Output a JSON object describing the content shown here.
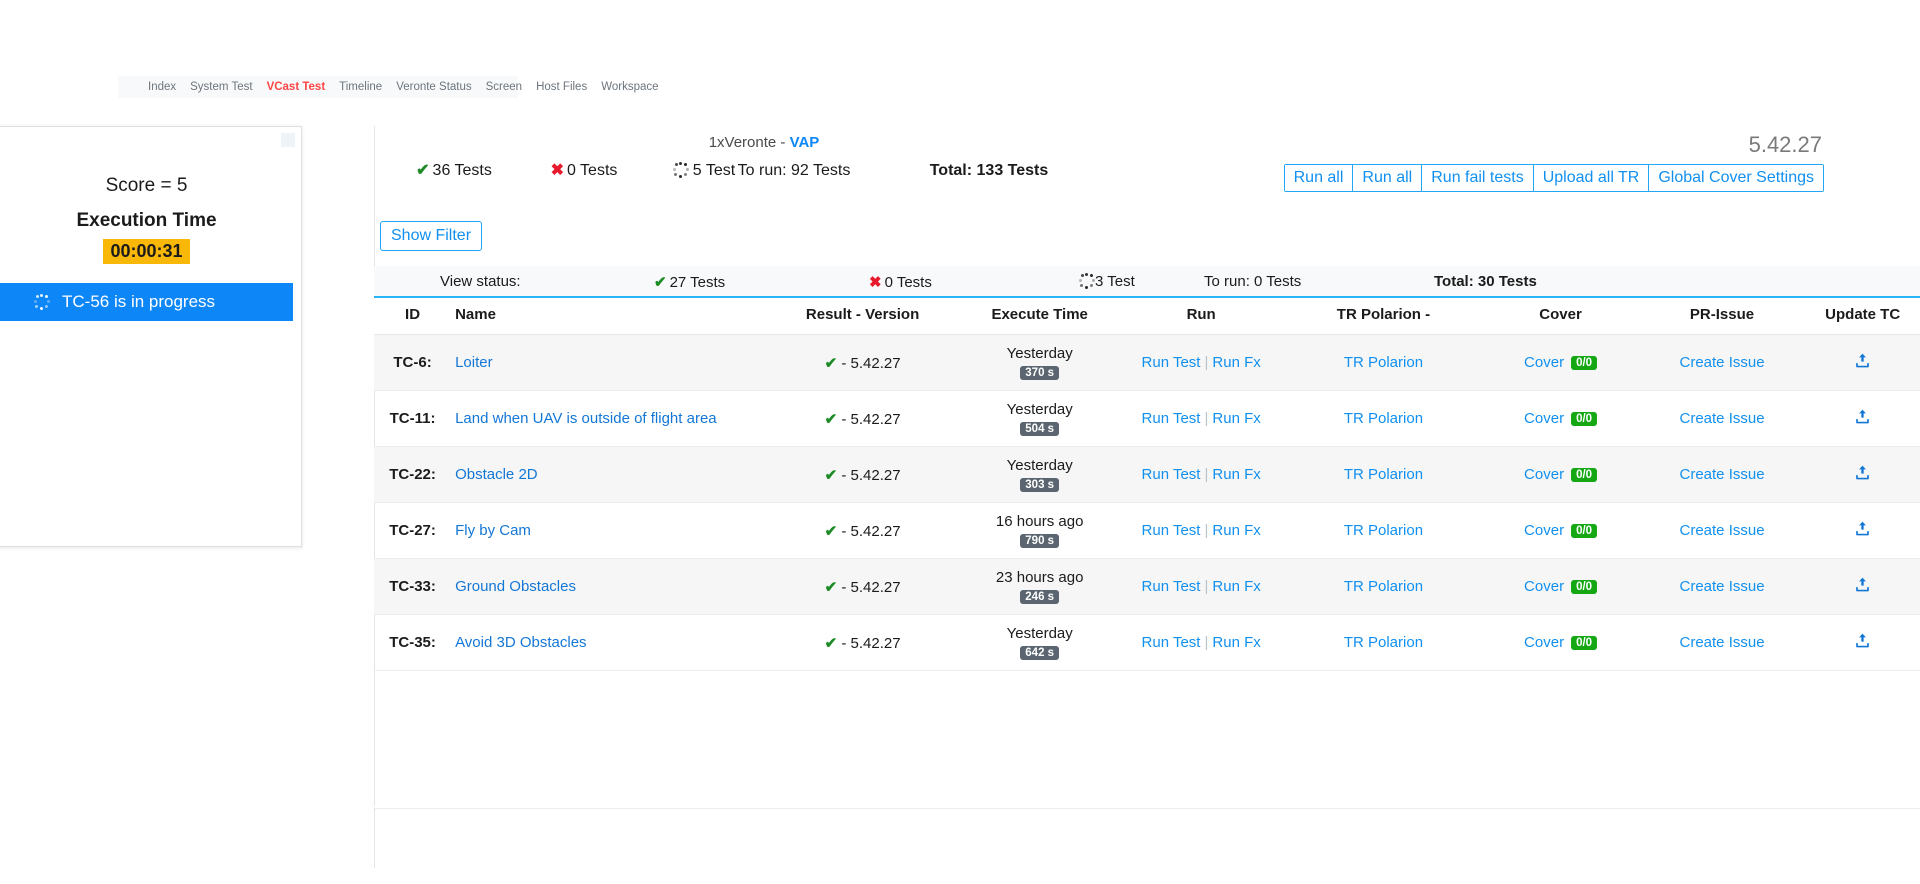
{
  "nav": {
    "items": [
      {
        "label": "Index",
        "active": false
      },
      {
        "label": "System Test",
        "active": false
      },
      {
        "label": "VCast Test",
        "active": true
      },
      {
        "label": "Timeline",
        "active": false
      },
      {
        "label": "Veronte Status",
        "active": false
      },
      {
        "label": "Screen",
        "active": false
      },
      {
        "label": "Host Files",
        "active": false
      },
      {
        "label": "Workspace",
        "active": false
      }
    ]
  },
  "left_panel": {
    "score_label": "Score = 5",
    "execution_time_label": "Execution Time",
    "execution_time_value": "00:00:31",
    "execution_time_bg": "#f9b708",
    "progress_text": "TC-56 is in progress",
    "progress_bg": "#0d87f7",
    "progress_icon": "spinner-icon"
  },
  "header": {
    "device_prefix": "1xVeronte - ",
    "device_name": "VAP",
    "version": "5.42.27",
    "stats": {
      "passed": "36 Tests",
      "failed": "0 Tests",
      "in_progress": "5 Test",
      "to_run": "To run: 92 Tests",
      "total": "Total: 133 Tests"
    },
    "buttons": [
      "Run all",
      "Run all",
      "Run fail tests",
      "Upload all TR",
      "Global Cover Settings"
    ],
    "show_filter": "Show Filter"
  },
  "view_status": {
    "label": "View status:",
    "passed": "27 Tests",
    "failed": "0 Tests",
    "in_progress": "3 Test",
    "to_run": "To run: 0 Tests",
    "total": "Total: 30 Tests"
  },
  "table": {
    "headers": {
      "id": "ID",
      "name": "Name",
      "result": "Result - Version",
      "time": "Execute Time",
      "run": "Run",
      "tr": "TR Polarion -",
      "cover": "Cover",
      "pr": "PR-Issue",
      "update": "Update TC"
    },
    "labels": {
      "run_test": "Run Test",
      "run_fx": "Run Fx",
      "tr_polarion": "TR Polarion",
      "cover": "Cover",
      "create_issue": "Create Issue",
      "upload_icon": "upload-icon"
    },
    "rows": [
      {
        "id": "TC-6:",
        "name": "Loiter",
        "result_version": "- 5.42.27",
        "result_status": "pass",
        "time": "Yesterday",
        "duration": "370 s",
        "cover_badge": "0/0"
      },
      {
        "id": "TC-11:",
        "name": "Land when UAV is outside of flight area",
        "result_version": "- 5.42.27",
        "result_status": "pass",
        "time": "Yesterday",
        "duration": "504 s",
        "cover_badge": "0/0"
      },
      {
        "id": "TC-22:",
        "name": "Obstacle 2D",
        "result_version": "- 5.42.27",
        "result_status": "pass",
        "time": "Yesterday",
        "duration": "303 s",
        "cover_badge": "0/0"
      },
      {
        "id": "TC-27:",
        "name": "Fly by Cam",
        "result_version": "- 5.42.27",
        "result_status": "pass",
        "time": "16 hours ago",
        "duration": "790 s",
        "cover_badge": "0/0"
      },
      {
        "id": "TC-33:",
        "name": "Ground Obstacles",
        "result_version": "- 5.42.27",
        "result_status": "pass",
        "time": "23 hours ago",
        "duration": "246 s",
        "cover_badge": "0/0"
      },
      {
        "id": "TC-35:",
        "name": "Avoid 3D Obstacles",
        "result_version": "- 5.42.27",
        "result_status": "pass",
        "time": "Yesterday",
        "duration": "642 s",
        "cover_badge": "0/0"
      }
    ]
  },
  "colors": {
    "accent_blue": "#1190f0",
    "link_blue": "#1477d6",
    "pass_green": "#1d8b26",
    "fail_red": "#e8192c",
    "badge_green": "#15a814",
    "badge_gray": "#5a6570",
    "nav_active_red": "#fd4646"
  }
}
